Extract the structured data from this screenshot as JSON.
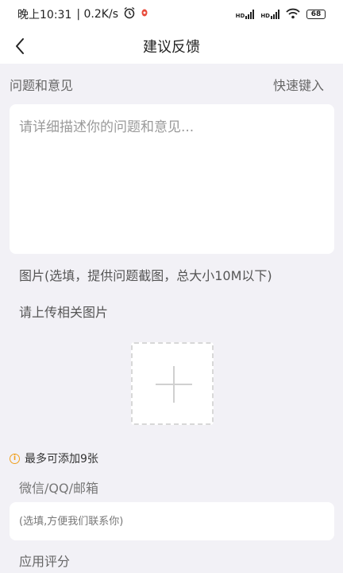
{
  "status_bar": {
    "time": "晚上10:31",
    "speed": "| 0.2K/s",
    "battery": "68",
    "signal1": "HD",
    "signal2": "HD"
  },
  "nav": {
    "title": "建议反馈"
  },
  "feedback": {
    "label": "问题和意见",
    "quick_input": "快速键入",
    "placeholder": "请详细描述你的问题和意见..."
  },
  "images": {
    "hint": "图片(选填，提供问题截图，总大小10M以下)",
    "upload_label": "请上传相关图片",
    "max_note": "最多可添加9张"
  },
  "contact": {
    "label": "微信/QQ/邮箱",
    "placeholder": "(选填,方便我们联系你)"
  },
  "rating": {
    "label": "应用评分"
  },
  "colors": {
    "accent": "#f0a020",
    "background": "#f2f1f6"
  }
}
